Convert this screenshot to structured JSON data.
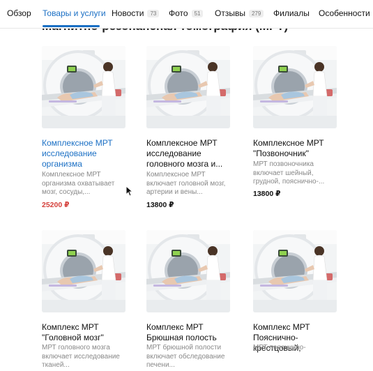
{
  "tabs": [
    {
      "label": "Обзор"
    },
    {
      "label": "Товары и услуги"
    },
    {
      "label": "Новости",
      "count": "73"
    },
    {
      "label": "Фото",
      "count": "51"
    },
    {
      "label": "Отзывы",
      "count": "279"
    },
    {
      "label": "Филиалы"
    },
    {
      "label": "Особенности"
    }
  ],
  "section": {
    "title": "Магнитно-резонансная томография (МРТ)"
  },
  "products": [
    {
      "title": "Комплексное МРТ исследование организма",
      "description": "Комплексное МРТ организма охватывает мозг, сосуды,...",
      "price": "25200 ₽"
    },
    {
      "title": "Комплексное МРТ исследование головного мозга и...",
      "description": "Комплексное МРТ включает головной мозг, артерии и вены...",
      "price": "13800 ₽"
    },
    {
      "title": "Комплексное МРТ \"Позвоночник\"",
      "description": "МРТ позвоночника включает шейный, грудной, пояснично-...",
      "price": "13800 ₽"
    },
    {
      "title": "Комплекс МРТ \"Головной мозг\"",
      "description": "МРТ головного мозга включает исследование тканей..."
    },
    {
      "title": "Комплекс МРТ Брюшная полость",
      "description": "МРТ брюшной полости включает обследование печени..."
    },
    {
      "title": "Комплекс МРТ Пояснично-крестцовый,",
      "description": "МРТ пояснично-"
    }
  ],
  "colors": {
    "accent": "#1a6fc4",
    "price_highlight": "#d43f3a"
  }
}
